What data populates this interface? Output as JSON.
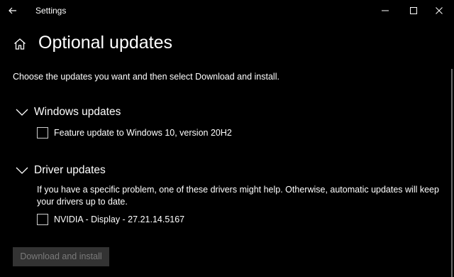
{
  "window": {
    "title": "Settings"
  },
  "icons": {
    "back": "arrow-left-icon",
    "minimize": "minimize-icon",
    "maximize": "maximize-icon",
    "close": "close-icon",
    "home": "home-icon",
    "chevron": "chevron-down-icon"
  },
  "page": {
    "title": "Optional updates",
    "intro": "Choose the updates you want and then select Download and install."
  },
  "windows_updates": {
    "header": "Windows updates",
    "items": [
      {
        "label": "Feature update to Windows 10, version 20H2",
        "checked": false
      }
    ]
  },
  "driver_updates": {
    "header": "Driver updates",
    "description": "If you have a specific problem, one of these drivers might help. Otherwise, automatic updates will keep your drivers up to date.",
    "items": [
      {
        "label": "NVIDIA - Display - 27.21.14.5167",
        "checked": false
      }
    ]
  },
  "actions": {
    "download_install": "Download and install",
    "download_install_enabled": false
  },
  "colors": {
    "background": "#000000",
    "text": "#ffffff",
    "button_disabled_bg": "#333333",
    "button_disabled_text": "#7a7a7a",
    "checkbox_border": "#cfcfcf"
  }
}
